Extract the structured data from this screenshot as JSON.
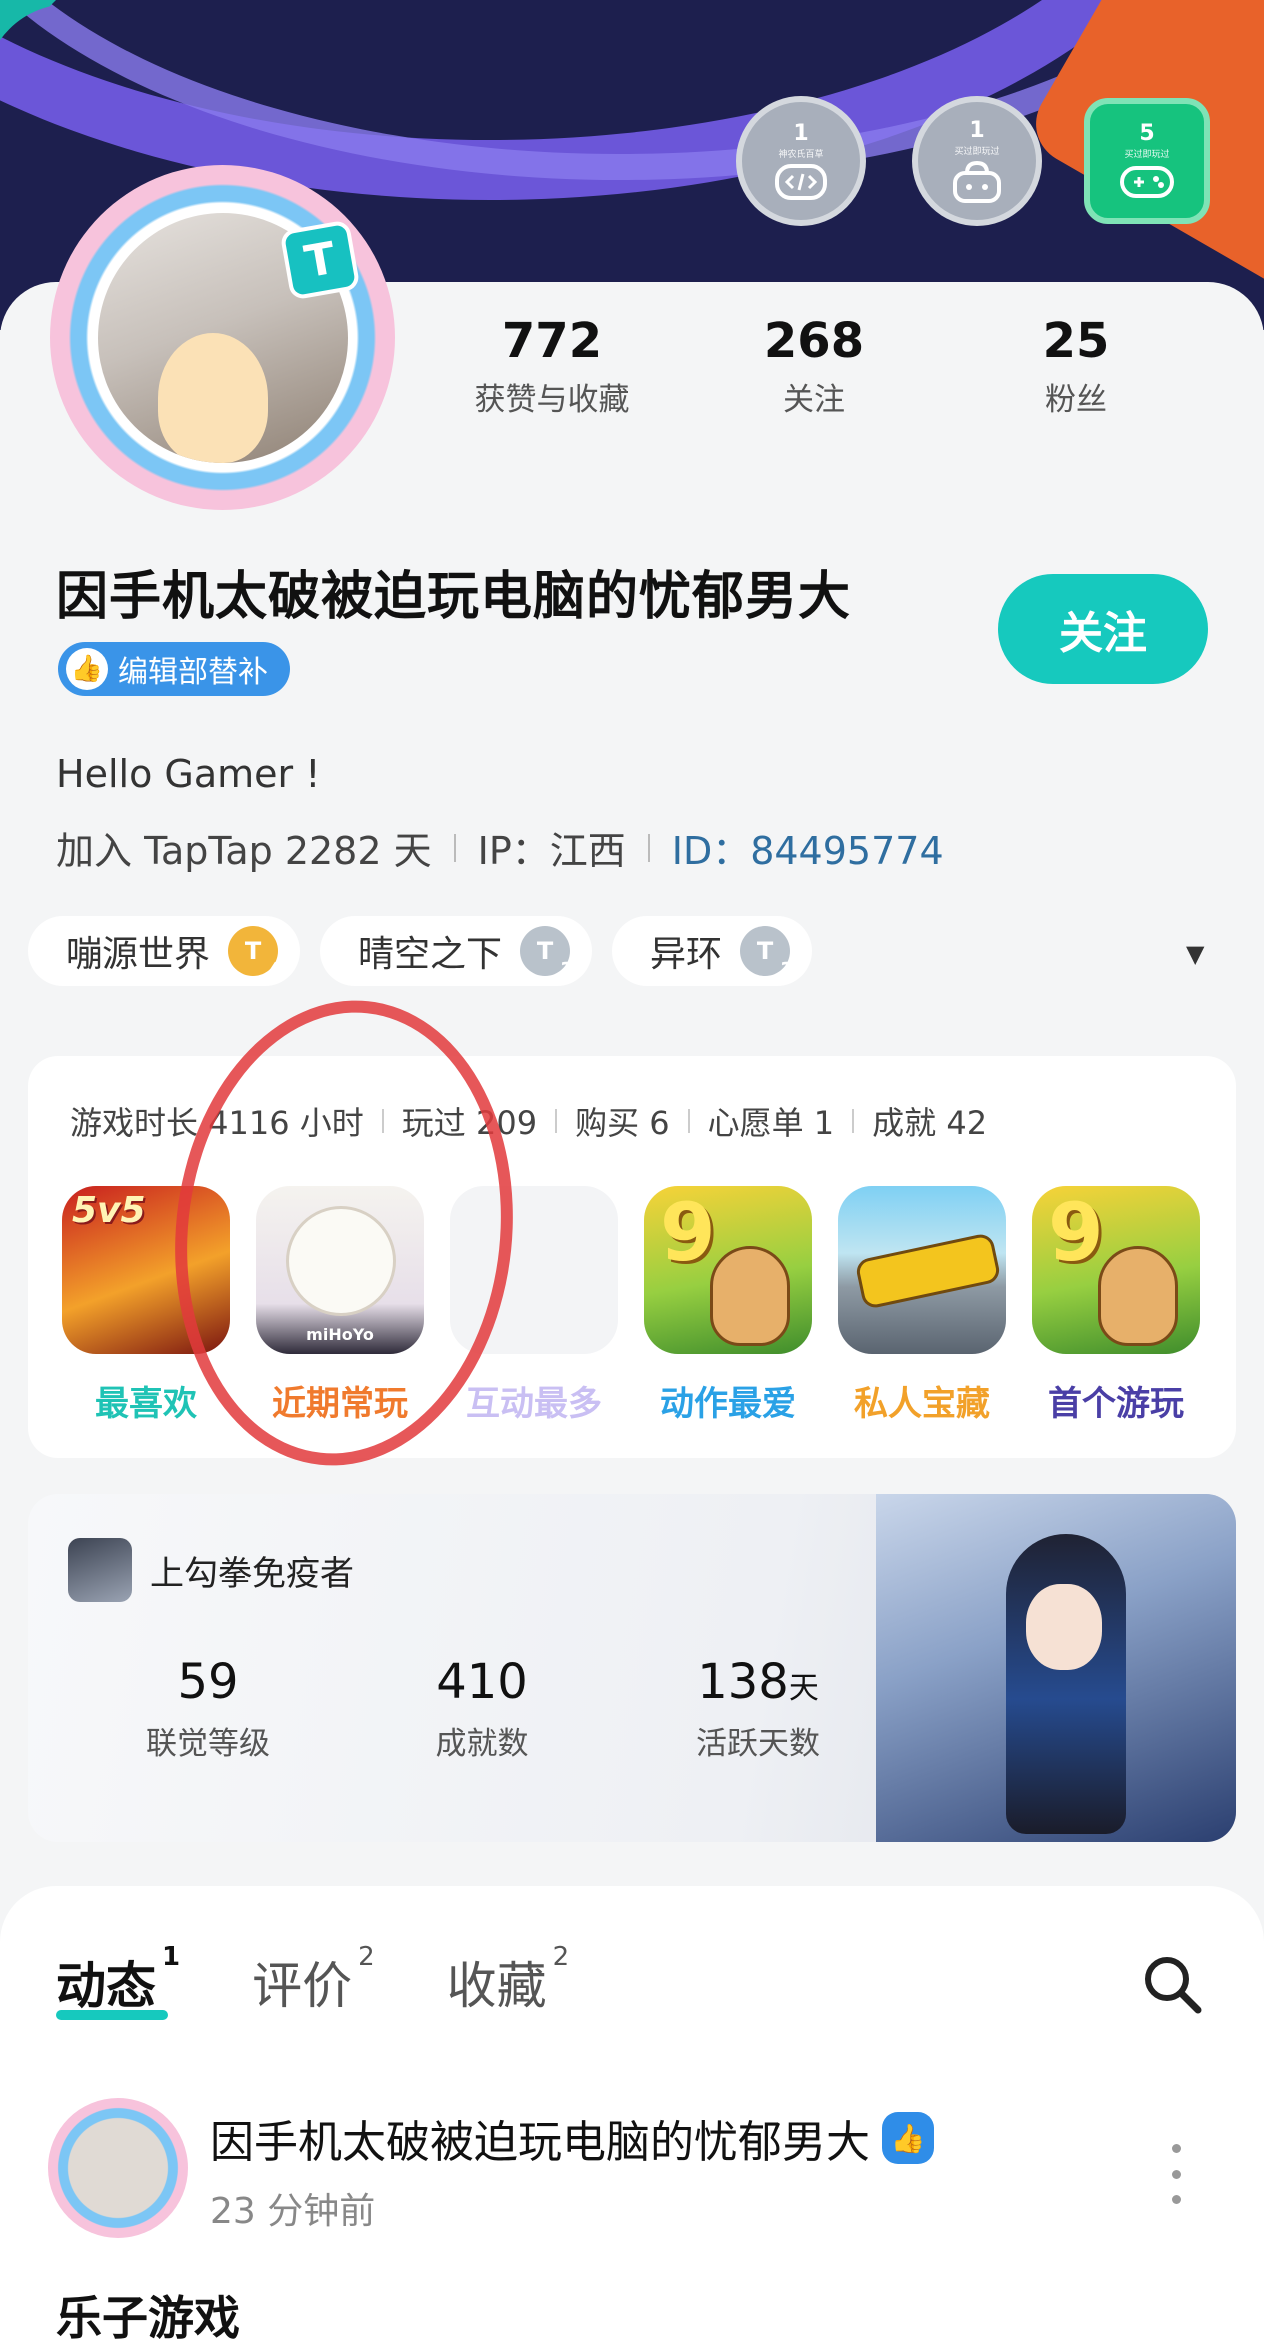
{
  "badges": [
    {
      "count": "1",
      "caption": "神农氏百草"
    },
    {
      "count": "1",
      "caption": "买过即玩过"
    },
    {
      "count": "5",
      "caption": "买过即玩过"
    }
  ],
  "stats": [
    {
      "value": "772",
      "label": "获赞与收藏"
    },
    {
      "value": "268",
      "label": "关注"
    },
    {
      "value": "25",
      "label": "粉丝"
    }
  ],
  "profile": {
    "name": "因手机太破被迫玩电脑的忧郁男大",
    "follow_label": "关注",
    "editor_tag": "编辑部替补",
    "bio": "Hello Gamer !",
    "joined": "加入 TapTap 2282 天",
    "ip": "IP：江西",
    "id": "ID：84495774"
  },
  "game_tags": [
    {
      "name": "嘣源世界",
      "level": "4"
    },
    {
      "name": "晴空之下",
      "level": "3"
    },
    {
      "name": "异环",
      "level": "3"
    }
  ],
  "game_stats": [
    "游戏时长 4116 小时",
    "玩过 209",
    "购买 6",
    "心愿单 1",
    "成就 42"
  ],
  "games": [
    {
      "caption": "最喜欢",
      "color": "#1fc3b5",
      "badge": "5v5"
    },
    {
      "caption": "近期常玩",
      "color": "#f07a2d",
      "badge": "miHoYo"
    },
    {
      "caption": "互动最多",
      "color": "#b8a6f0",
      "badge": ""
    },
    {
      "caption": "动作最爱",
      "color": "#2aa1e6",
      "badge": "9"
    },
    {
      "caption": "私人宝藏",
      "color": "#f2a12a",
      "badge": ""
    },
    {
      "caption": "首个游玩",
      "color": "#4a3fa6",
      "badge": "9"
    }
  ],
  "achievements": {
    "game": "上勾拳免疫者",
    "items": [
      {
        "value": "59",
        "unit": "",
        "label": "联觉等级"
      },
      {
        "value": "410",
        "unit": "",
        "label": "成就数"
      },
      {
        "value": "138",
        "unit": "天",
        "label": "活跃天数"
      }
    ]
  },
  "tabs": [
    {
      "label": "动态",
      "count": "1"
    },
    {
      "label": "评价",
      "count": "2"
    },
    {
      "label": "收藏",
      "count": "2"
    }
  ],
  "post": {
    "author": "因手机太破被迫玩电脑的忧郁男大",
    "time": "23 分钟前",
    "title": "乐子游戏"
  },
  "colors": {
    "accent": "#16c9be",
    "id_link": "#2f6ea0",
    "editor_tag": "#3a94e8",
    "annotation_circle": "#e23a3c"
  }
}
